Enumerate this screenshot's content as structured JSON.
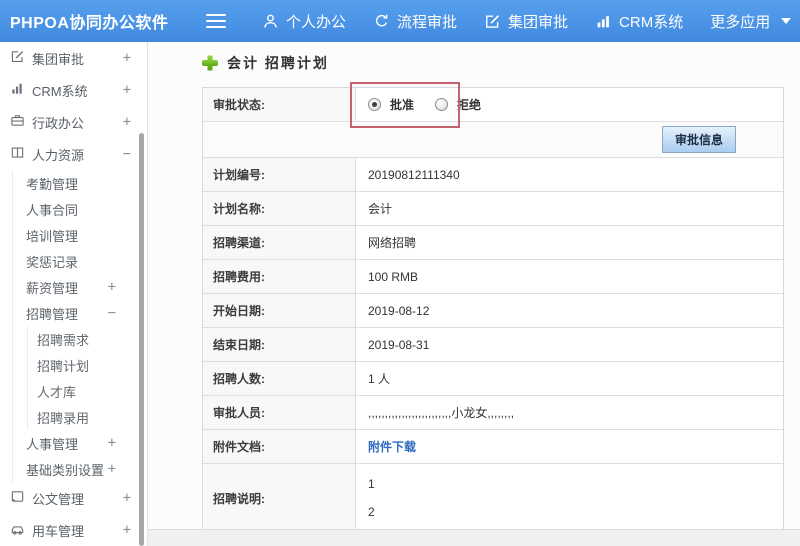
{
  "colors": {
    "header_blue": "#4a92e4",
    "link_blue": "#2e6cc0",
    "annotation_red": "#c4636e",
    "plus_green": "#68b31f",
    "button_face": "#c4ddf4"
  },
  "header": {
    "logo": "PHPOA协同办公软件",
    "nav": [
      {
        "label": "个人办公",
        "icon": "person-icon"
      },
      {
        "label": "流程审批",
        "icon": "process-icon"
      },
      {
        "label": "集团审批",
        "icon": "edit-icon"
      },
      {
        "label": "CRM系统",
        "icon": "chart-icon"
      },
      {
        "label": "更多应用",
        "icon": "caret-down-icon"
      }
    ]
  },
  "sidebar": {
    "items": [
      {
        "label": "集团审批",
        "level": 1,
        "icon": "edit-icon",
        "expander": "+"
      },
      {
        "label": "CRM系统",
        "level": 1,
        "icon": "chart-icon",
        "expander": "+"
      },
      {
        "label": "行政办公",
        "level": 1,
        "icon": "briefcase-icon",
        "expander": "+"
      },
      {
        "label": "人力资源",
        "level": 1,
        "icon": "book-icon",
        "expander": "−",
        "expanded": true
      },
      {
        "label": "考勤管理",
        "level": 2
      },
      {
        "label": "人事合同",
        "level": 2
      },
      {
        "label": "培训管理",
        "level": 2
      },
      {
        "label": "奖惩记录",
        "level": 2
      },
      {
        "label": "薪资管理",
        "level": 2,
        "expander": "+"
      },
      {
        "label": "招聘管理",
        "level": 2,
        "expander": "−",
        "expanded": true
      },
      {
        "label": "招聘需求",
        "level": 3
      },
      {
        "label": "招聘计划",
        "level": 3
      },
      {
        "label": "人才库",
        "level": 3
      },
      {
        "label": "招聘录用",
        "level": 3
      },
      {
        "label": "人事管理",
        "level": 2,
        "expander": "+"
      },
      {
        "label": "基础类别设置",
        "level": 2,
        "expander": "+"
      },
      {
        "label": "公文管理",
        "level": 1,
        "icon": "document-icon",
        "expander": "+"
      },
      {
        "label": "用车管理",
        "level": 1,
        "icon": "car-icon",
        "expander": "+"
      }
    ]
  },
  "main": {
    "title": "会计 招聘计划",
    "approval": {
      "status_label": "审批状态:",
      "options": [
        {
          "label": "批准",
          "checked": true
        },
        {
          "label": "拒绝",
          "checked": false
        }
      ],
      "info_button": "审批信息"
    },
    "fields": [
      {
        "label": "计划编号:",
        "value": "20190812111340"
      },
      {
        "label": "计划名称:",
        "value": "会计"
      },
      {
        "label": "招聘渠道:",
        "value": "网络招聘"
      },
      {
        "label": "招聘费用:",
        "value": "100 RMB"
      },
      {
        "label": "开始日期:",
        "value": "2019-08-12"
      },
      {
        "label": "结束日期:",
        "value": "2019-08-31"
      },
      {
        "label": "招聘人数:",
        "value": "1 人"
      },
      {
        "label": "审批人员:",
        "value": ",,,,,,,,,,,,,,,,,,,,,,,,,小龙女,,,,,,,,"
      },
      {
        "label": "附件文档:",
        "value": "附件下载"
      },
      {
        "label": "招聘说明:",
        "value": "1\n2"
      }
    ]
  }
}
